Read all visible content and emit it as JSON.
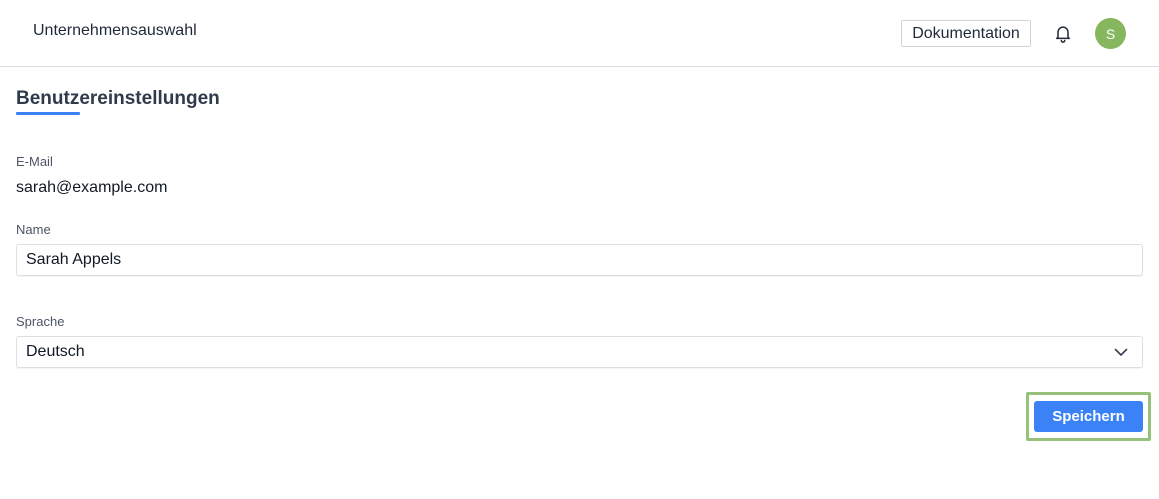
{
  "header": {
    "company_selector": "Unternehmensauswahl",
    "documentation_label": "Dokumentation",
    "avatar_initial": "S",
    "avatar_color": "#86b65e"
  },
  "page": {
    "title": "Benutzereinstellungen",
    "accent_color": "#3b82f6"
  },
  "form": {
    "email": {
      "label": "E-Mail",
      "value": "sarah@example.com"
    },
    "name": {
      "label": "Name",
      "value": "Sarah Appels"
    },
    "language": {
      "label": "Sprache",
      "selected": "Deutsch"
    },
    "save_label": "Speichern"
  },
  "icons": {
    "notifications": "bell-icon",
    "dropdown": "chevron-down-icon"
  }
}
